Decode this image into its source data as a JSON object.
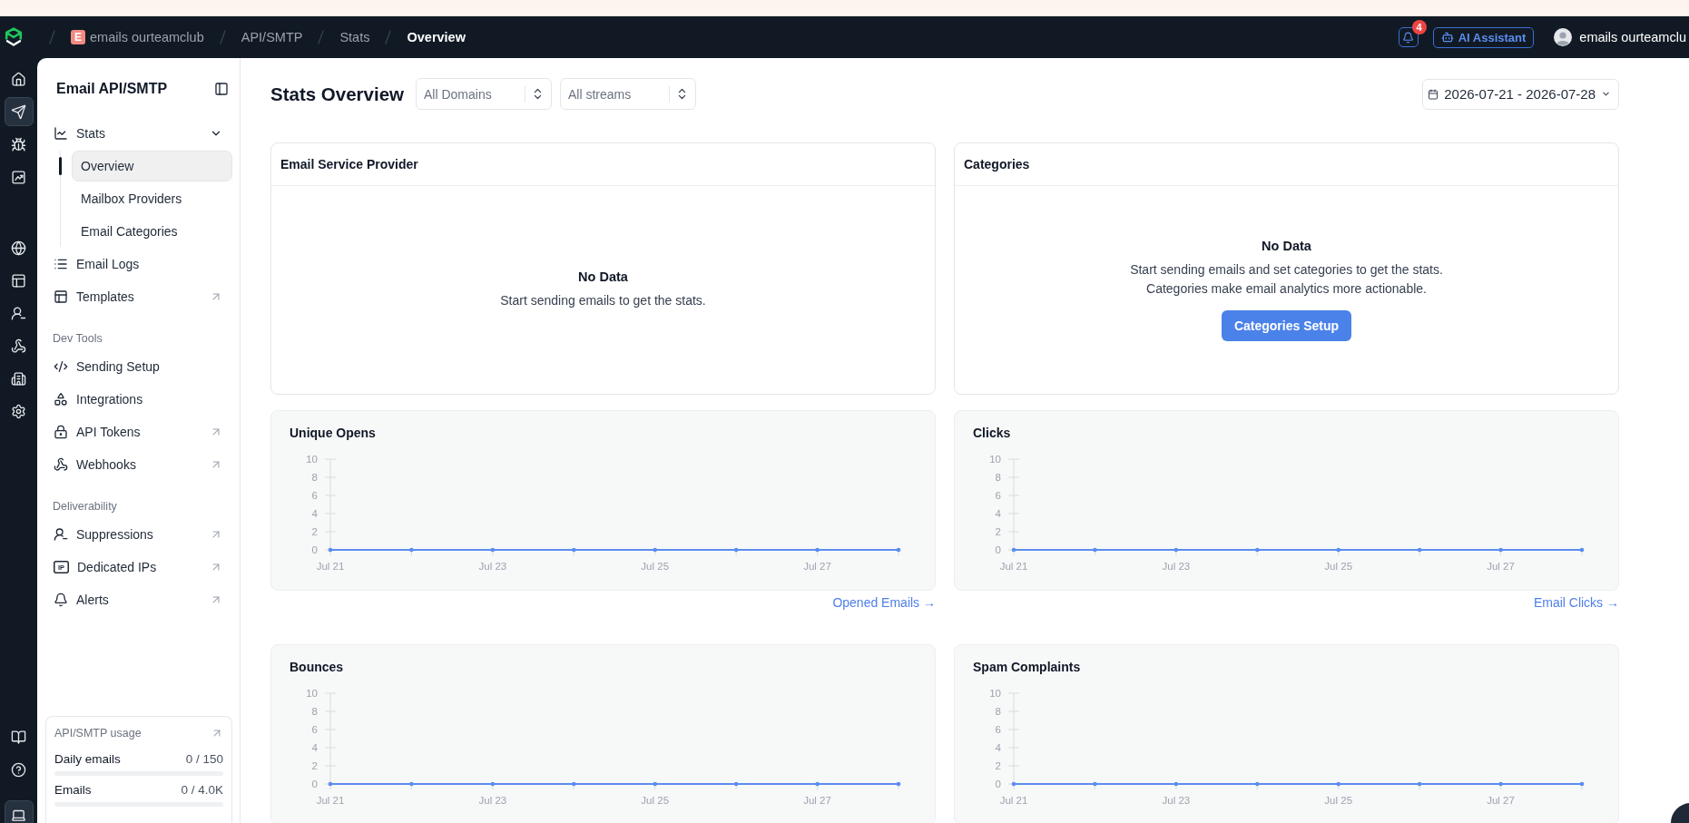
{
  "top_nav": {
    "breadcrumbs": [
      {
        "badge": "E",
        "label": "emails ourteamclub",
        "selected": false
      },
      {
        "label": "API/SMTP",
        "selected": false
      },
      {
        "label": "Stats",
        "selected": false
      },
      {
        "label": "Overview",
        "selected": true
      }
    ],
    "notifications": {
      "count": "4"
    },
    "assistant_button": {
      "label": "AI Assistant"
    },
    "user": {
      "name": "emails ourteamclu"
    }
  },
  "icon_rail": {
    "top": [
      {
        "selected": false
      },
      {
        "selected": true
      },
      {
        "selected": false
      },
      {
        "selected": false
      }
    ],
    "middle": [
      {
        "selected": false
      },
      {
        "selected": false
      },
      {
        "selected": false
      },
      {
        "selected": false
      },
      {
        "selected": false
      },
      {
        "selected": false
      }
    ],
    "bottom": [
      {
        "selected": false
      },
      {
        "selected": false
      },
      {
        "selected": true
      }
    ]
  },
  "sidebar": {
    "title": "Email API/SMTP",
    "sections": [
      {
        "items": [
          {
            "label": "Stats",
            "selected": false,
            "expanded": true,
            "external": false,
            "children": [
              {
                "label": "Overview",
                "selected": true
              },
              {
                "label": "Mailbox Providers",
                "selected": false
              },
              {
                "label": "Email Categories",
                "selected": false
              }
            ]
          },
          {
            "label": "Email Logs",
            "selected": false,
            "external": false
          },
          {
            "label": "Templates",
            "selected": false,
            "external": true
          }
        ]
      },
      {
        "heading": "Dev Tools",
        "items": [
          {
            "label": "Sending Setup",
            "selected": false,
            "external": false
          },
          {
            "label": "Integrations",
            "selected": false,
            "external": false
          },
          {
            "label": "API Tokens",
            "selected": false,
            "external": true
          },
          {
            "label": "Webhooks",
            "selected": false,
            "external": true
          }
        ]
      },
      {
        "heading": "Deliverability",
        "items": [
          {
            "label": "Suppressions",
            "selected": false,
            "external": true
          },
          {
            "label": "Dedicated IPs",
            "icon_text": "IP",
            "selected": false,
            "external": true
          },
          {
            "label": "Alerts",
            "selected": false,
            "external": true
          }
        ]
      }
    ],
    "usage": {
      "title": "API/SMTP usage",
      "meters": [
        {
          "label": "Daily emails",
          "reading": "0 / 150",
          "level": 0
        },
        {
          "label": "Emails",
          "reading": "0 / 4.0K",
          "level": 0
        }
      ]
    }
  },
  "page": {
    "title": "Stats Overview",
    "filters": [
      {
        "value": "All Domains"
      },
      {
        "value": "All streams"
      }
    ],
    "date_range": {
      "value": "2026-07-21 - 2026-07-28"
    }
  },
  "cards": [
    {
      "kind": "empty",
      "title": "Email Service Provider",
      "empty_title": "No Data",
      "message_lines": [
        "Start sending emails to get the stats."
      ]
    },
    {
      "kind": "empty",
      "title": "Categories",
      "empty_title": "No Data",
      "message_lines": [
        "Start sending emails and set categories to get the stats.",
        "Categories make email analytics more actionable."
      ],
      "button": "Categories Setup"
    },
    {
      "kind": "chart",
      "title": "Unique Opens",
      "link": "Opened Emails →",
      "chart_data": {
        "type": "line",
        "categories": [
          "Jul 21",
          null,
          "Jul 23",
          null,
          "Jul 25",
          null,
          "Jul 27",
          null
        ],
        "series": [
          {
            "color": "#5b8def",
            "values": [
              0,
              0,
              0,
              0,
              0,
              0,
              0,
              0
            ]
          }
        ],
        "yticks": [
          0,
          2,
          4,
          6,
          8,
          10
        ],
        "ylim": [
          0,
          10
        ]
      }
    },
    {
      "kind": "chart",
      "title": "Clicks",
      "link": "Email Clicks →",
      "chart_data": {
        "type": "line",
        "categories": [
          "Jul 21",
          null,
          "Jul 23",
          null,
          "Jul 25",
          null,
          "Jul 27",
          null
        ],
        "series": [
          {
            "color": "#5b8def",
            "values": [
              0,
              0,
              0,
              0,
              0,
              0,
              0,
              0
            ]
          }
        ],
        "yticks": [
          0,
          2,
          4,
          6,
          8,
          10
        ],
        "ylim": [
          0,
          10
        ]
      }
    },
    {
      "kind": "chart",
      "title": "Bounces",
      "chart_data": {
        "type": "line",
        "categories": [
          "Jul 21",
          null,
          "Jul 23",
          null,
          "Jul 25",
          null,
          "Jul 27",
          null
        ],
        "series": [
          {
            "color": "#5b8def",
            "values": [
              0,
              0,
              0,
              0,
              0,
              0,
              0,
              0
            ]
          }
        ],
        "yticks": [
          0,
          2,
          4,
          6,
          8,
          10
        ],
        "ylim": [
          0,
          10
        ]
      }
    },
    {
      "kind": "chart",
      "title": "Spam Complaints",
      "chart_data": {
        "type": "line",
        "categories": [
          "Jul 21",
          null,
          "Jul 23",
          null,
          "Jul 25",
          null,
          "Jul 27",
          null
        ],
        "series": [
          {
            "color": "#5b8def",
            "values": [
              0,
              0,
              0,
              0,
              0,
              0,
              0,
              0
            ]
          }
        ],
        "yticks": [
          0,
          2,
          4,
          6,
          8,
          10
        ],
        "ylim": [
          0,
          10
        ]
      }
    }
  ]
}
